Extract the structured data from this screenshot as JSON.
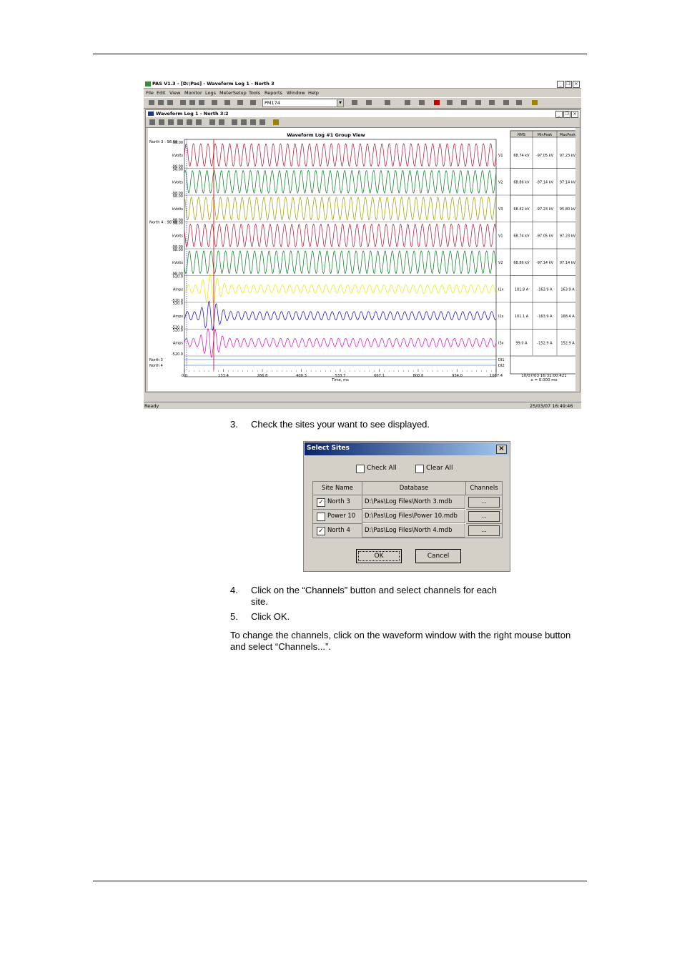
{
  "app": {
    "title": "PAS V1.3 - [D:\\Pas] - Waveform Log 1 - North 3",
    "window_buttons": [
      "_",
      "❐",
      "×"
    ],
    "menu": [
      "File",
      "Edit",
      "View",
      "Monitor",
      "Logs",
      "MeterSetup",
      "Tools",
      "Reports",
      "Window",
      "Help"
    ],
    "device_combo": "PM174",
    "child_title": "Waveform Log 1 - North 3:2",
    "status_left": "Ready",
    "status_right": "25/03/07 16:49:46"
  },
  "plot": {
    "title": "Waveform Log #1 Group View",
    "site_labels": [
      "North 3 : 98.00",
      "North 4 : 98.00",
      "North 3",
      "North 4"
    ],
    "channels": [
      {
        "unit": "kVolts",
        "top": "98.00",
        "bottom": "-98.00",
        "name": "V1",
        "color": "#b0102c",
        "rms": "68.74 kV",
        "minpeak": "-97.05 kV",
        "maxpeak": "97.23 kV"
      },
      {
        "unit": "kVolts",
        "top": "98.00",
        "bottom": "-98.00",
        "name": "V2",
        "color": "#007a1c",
        "rms": "68.86 kV",
        "minpeak": "-97.14 kV",
        "maxpeak": "97.14 kV"
      },
      {
        "unit": "kVolts",
        "top": "98.00",
        "bottom": "-98.00",
        "name": "V3",
        "color": "#9a9a00",
        "rms": "68.42 kV",
        "minpeak": "-97.23 kV",
        "maxpeak": "95.80 kV"
      },
      {
        "unit": "kVolts",
        "top": "98.00",
        "bottom": "-98.00",
        "name": "V1",
        "color": "#b0102c",
        "rms": "68.74 kV",
        "minpeak": "-97.05 kV",
        "maxpeak": "97.23 kV"
      },
      {
        "unit": "kVolts",
        "top": "98.00",
        "bottom": "-98.00",
        "name": "V2",
        "color": "#007a1c",
        "rms": "68.86 kV",
        "minpeak": "-97.14 kV",
        "maxpeak": "97.14 kV"
      },
      {
        "unit": "Amps",
        "top": "520.0",
        "bottom": "-520.0",
        "name": "I1x",
        "color": "#e8e800",
        "rms": "101.8 A",
        "minpeak": "-163.9 A",
        "maxpeak": "163.9 A"
      },
      {
        "unit": "Amps",
        "top": "520.0",
        "bottom": "-520.0",
        "name": "I2x",
        "color": "#0000d0",
        "rms": "101.1 A",
        "minpeak": "-163.9 A",
        "maxpeak": "168.4 A"
      },
      {
        "unit": "Amps",
        "top": "520.0",
        "bottom": "-520.0",
        "name": "I3x",
        "color": "#e000c8",
        "rms": "99.0 A",
        "minpeak": "-152.9 A",
        "maxpeak": "152.9 A"
      }
    ],
    "digital": [
      {
        "site": "North 3",
        "name": "DI1"
      },
      {
        "site": "North 4",
        "name": "DI2"
      }
    ],
    "x_ticks": [
      "0.0",
      "133.4",
      "266.8",
      "400.3",
      "533.7",
      "667.1",
      "800.6",
      "934.0",
      "1067.4"
    ],
    "x_label": "Time, ms",
    "table_headers": [
      "RMS",
      "MinPeak",
      "MaxPeak"
    ],
    "timestamp": "10/07/03 16:31:00.421",
    "cursor_readout": "x = 0.000 ms"
  },
  "steps": [
    {
      "num": "3.",
      "text": "Check the sites your want to see displayed."
    },
    {
      "num": "4.",
      "text": "Click on the “Channels” button and select channels for each site."
    },
    {
      "num": "5.",
      "text": "Click OK."
    }
  ],
  "dialog": {
    "title": "Select Sites",
    "close": "×",
    "check_all": "Check All",
    "clear_all": "Clear All",
    "headers": [
      "Site Name",
      "Database",
      "Channels"
    ],
    "rows": [
      {
        "site": "North 3",
        "database": "D:\\Pas\\Log Files\\North 3.mdb",
        "checked": true,
        "button": "..."
      },
      {
        "site": "Power 10",
        "database": "D:\\Pas\\Log Files\\Power 10.mdb",
        "checked": false,
        "button": "..."
      },
      {
        "site": "North 4",
        "database": "D:\\Pas\\Log Files\\North 4.mdb",
        "checked": true,
        "button": "..."
      }
    ],
    "ok": "OK",
    "cancel": "Cancel"
  },
  "paragraph": "To change the channels, click on the waveform window with the right mouse button and select “Channels...”."
}
